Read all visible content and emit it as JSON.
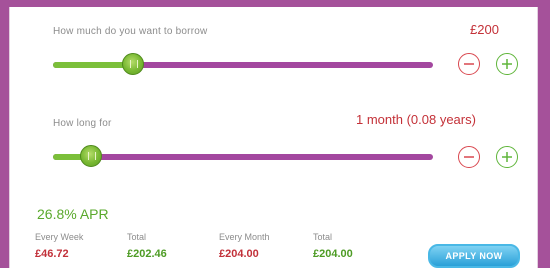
{
  "borrow": {
    "label": "How much do you want to borrow",
    "value": "£200",
    "slider_level": 0.21
  },
  "duration": {
    "label": "How long for",
    "value": "1 month (0.08 years)",
    "slider_level": 0.1
  },
  "apr": "26.8% APR",
  "summary": {
    "every_week_label": "Every Week",
    "every_week_value": "£46.72",
    "total_week_label": "Total",
    "total_week_value": "£202.46",
    "every_month_label": "Every Month",
    "every_month_value": "£204.00",
    "total_month_label": "Total",
    "total_month_value": "£204.00"
  },
  "apply_label": "APPLY NOW",
  "colors": {
    "frame": "#a5519a",
    "track": "#a3479f",
    "track_fill": "#7bbf3a",
    "minus": "#d9474f",
    "plus": "#5fb53a",
    "apply": "#2aa0d8"
  },
  "icons": {
    "minus": "minus-circle-icon",
    "plus": "plus-circle-icon",
    "thumb": "slider-thumb-icon"
  }
}
